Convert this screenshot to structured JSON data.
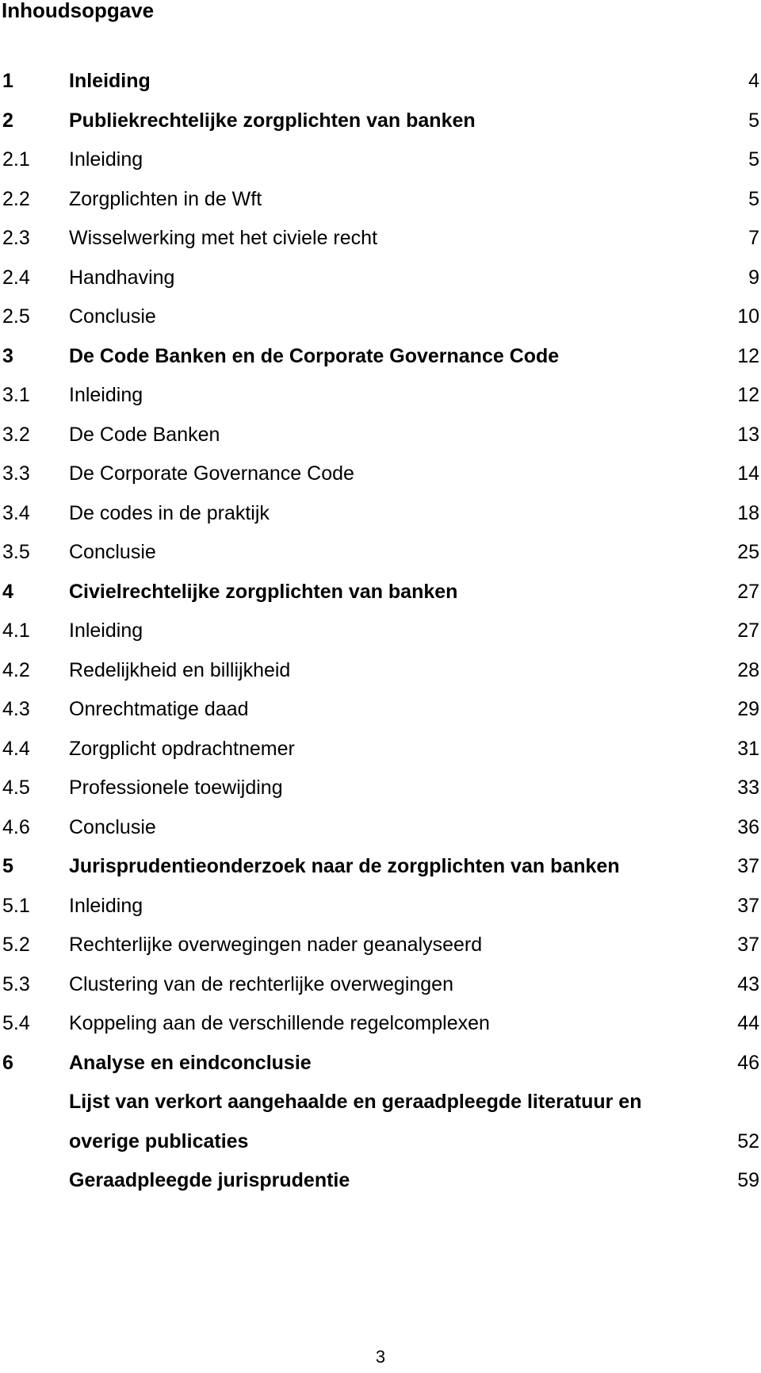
{
  "header": {
    "title": "Inhoudsopgave"
  },
  "toc": [
    {
      "num": "1",
      "title": "Inleiding",
      "page": "4",
      "level": 1
    },
    {
      "num": "2",
      "title": "Publiekrechtelijke zorgplichten van banken",
      "page": "5",
      "level": 1
    },
    {
      "num": "2.1",
      "title": "Inleiding",
      "page": "5",
      "level": 2
    },
    {
      "num": "2.2",
      "title": "Zorgplichten in de Wft",
      "page": "5",
      "level": 2
    },
    {
      "num": "2.3",
      "title": "Wisselwerking met het civiele recht",
      "page": "7",
      "level": 2
    },
    {
      "num": "2.4",
      "title": "Handhaving",
      "page": "9",
      "level": 2
    },
    {
      "num": "2.5",
      "title": "Conclusie",
      "page": "10",
      "level": 2
    },
    {
      "num": "3",
      "title": "De Code Banken en de Corporate Governance Code",
      "page": "12",
      "level": 1
    },
    {
      "num": "3.1",
      "title": "Inleiding",
      "page": "12",
      "level": 2
    },
    {
      "num": "3.2",
      "title": "De Code Banken",
      "page": "13",
      "level": 2
    },
    {
      "num": "3.3",
      "title": "De Corporate Governance Code",
      "page": "14",
      "level": 2
    },
    {
      "num": "3.4",
      "title": "De codes in de praktijk",
      "page": "18",
      "level": 2
    },
    {
      "num": "3.5",
      "title": "Conclusie",
      "page": "25",
      "level": 2
    },
    {
      "num": "4",
      "title": "Civielrechtelijke zorgplichten van banken",
      "page": "27",
      "level": 1
    },
    {
      "num": "4.1",
      "title": "Inleiding",
      "page": "27",
      "level": 2
    },
    {
      "num": "4.2",
      "title": "Redelijkheid en billijkheid",
      "page": "28",
      "level": 2
    },
    {
      "num": "4.3",
      "title": "Onrechtmatige daad",
      "page": "29",
      "level": 2
    },
    {
      "num": "4.4",
      "title": "Zorgplicht opdrachtnemer",
      "page": "31",
      "level": 2
    },
    {
      "num": "4.5",
      "title": "Professionele toewijding",
      "page": "33",
      "level": 2
    },
    {
      "num": "4.6",
      "title": "Conclusie",
      "page": "36",
      "level": 2
    },
    {
      "num": "5",
      "title": "Jurisprudentieonderzoek naar de zorgplichten van banken",
      "page": "37",
      "level": 1
    },
    {
      "num": "5.1",
      "title": "Inleiding",
      "page": "37",
      "level": 2
    },
    {
      "num": "5.2",
      "title": "Rechterlijke overwegingen nader geanalyseerd",
      "page": "37",
      "level": 2
    },
    {
      "num": "5.3",
      "title": "Clustering van de rechterlijke overwegingen",
      "page": "43",
      "level": 2
    },
    {
      "num": "5.4",
      "title": "Koppeling aan de verschillende regelcomplexen",
      "page": "44",
      "level": 2
    },
    {
      "num": "6",
      "title": "Analyse en eindconclusie",
      "page": "46",
      "level": 1
    },
    {
      "num": "",
      "title": "Lijst van verkort aangehaalde en geraadpleegde literatuur en",
      "page": "",
      "level": 1
    },
    {
      "num": "",
      "title": "overige publicaties",
      "page": "52",
      "level": 1
    },
    {
      "num": "",
      "title": "Geraadpleegde jurisprudentie",
      "page": "59",
      "level": 1
    }
  ],
  "footer": {
    "page_number": "3"
  }
}
